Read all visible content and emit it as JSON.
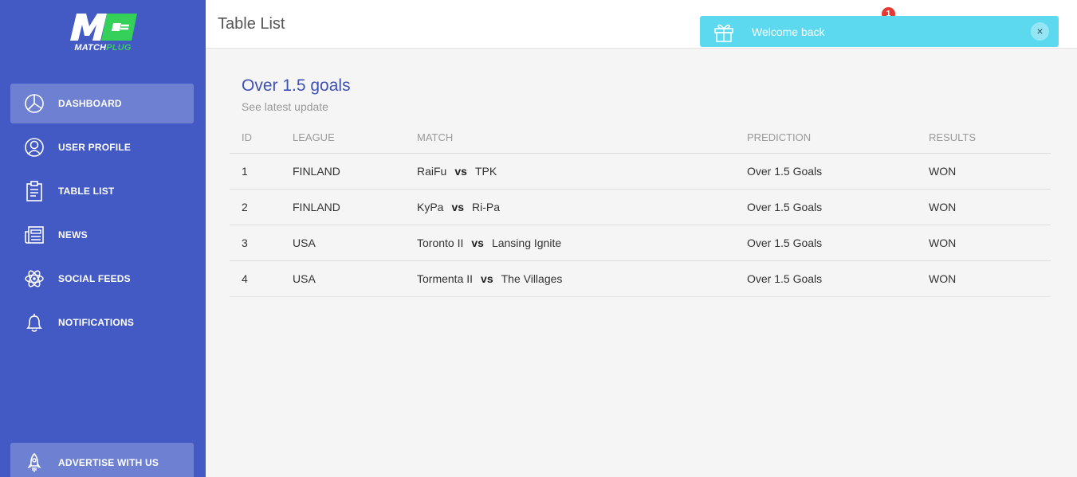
{
  "app": {
    "logo_letters": "M",
    "logo_match": "MATCH",
    "logo_plug": "PLUG",
    "brand_blue": "#435ac4",
    "brand_green": "#35d05a"
  },
  "sidebar": {
    "items": [
      {
        "label": "DASHBOARD",
        "icon": "pie-chart-icon"
      },
      {
        "label": "USER PROFILE",
        "icon": "user-circle-icon"
      },
      {
        "label": "TABLE LIST",
        "icon": "clipboard-icon"
      },
      {
        "label": "NEWS",
        "icon": "newspaper-icon"
      },
      {
        "label": "SOCIAL FEEDS",
        "icon": "atom-icon"
      },
      {
        "label": "NOTIFICATIONS",
        "icon": "bell-icon"
      }
    ],
    "advertise_label": "ADVERTISE WITH US"
  },
  "header": {
    "title": "Table List",
    "notification_count": "1"
  },
  "toast": {
    "message": "Welcome back",
    "close": "×",
    "color": "#5dd9ef"
  },
  "card": {
    "title": "Over 1.5 goals",
    "subtitle": "See latest update"
  },
  "table": {
    "headers": [
      "ID",
      "LEAGUE",
      "MATCH",
      "PREDICTION",
      "RESULTS"
    ],
    "vs_label": "vs",
    "rows": [
      {
        "id": "1",
        "league": "FINLAND",
        "home": "RaiFu",
        "away": "TPK",
        "prediction": "Over 1.5 Goals",
        "result": "WON"
      },
      {
        "id": "2",
        "league": "FINLAND",
        "home": "KyPa",
        "away": "Ri-Pa",
        "prediction": "Over 1.5 Goals",
        "result": "WON"
      },
      {
        "id": "3",
        "league": "USA",
        "home": "Toronto II",
        "away": "Lansing Ignite",
        "prediction": "Over 1.5 Goals",
        "result": "WON"
      },
      {
        "id": "4",
        "league": "USA",
        "home": "Tormenta II",
        "away": "The Villages",
        "prediction": "Over 1.5 Goals",
        "result": "WON"
      }
    ]
  }
}
